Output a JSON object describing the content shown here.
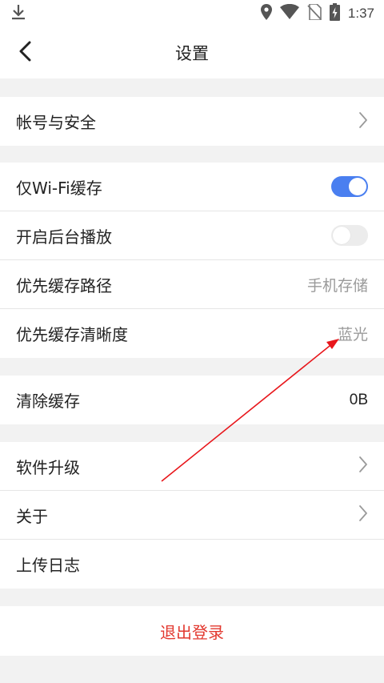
{
  "status_bar": {
    "time": "1:37",
    "icons": [
      "download-icon",
      "location-icon",
      "wifi-icon",
      "no-sim-icon",
      "battery-charging-icon"
    ]
  },
  "header": {
    "title": "设置",
    "back_icon": "chevron-left-icon"
  },
  "sections": {
    "account": {
      "label": "帐号与安全"
    },
    "cache": {
      "wifi_only": {
        "label": "仅Wi-Fi缓存",
        "enabled": true
      },
      "background_play": {
        "label": "开启后台播放",
        "enabled": false
      },
      "cache_path": {
        "label": "优先缓存路径",
        "value": "手机存储"
      },
      "cache_quality": {
        "label": "优先缓存清晰度",
        "value": "蓝光"
      }
    },
    "clear": {
      "label": "清除缓存",
      "value": "0B"
    },
    "misc": {
      "upgrade": {
        "label": "软件升级"
      },
      "about": {
        "label": "关于"
      },
      "upload_log": {
        "label": "上传日志"
      }
    }
  },
  "logout": {
    "label": "退出登录"
  },
  "colors": {
    "accent": "#4a7ff0",
    "logout": "#e2382f",
    "annotation_arrow": "#e8161b"
  }
}
